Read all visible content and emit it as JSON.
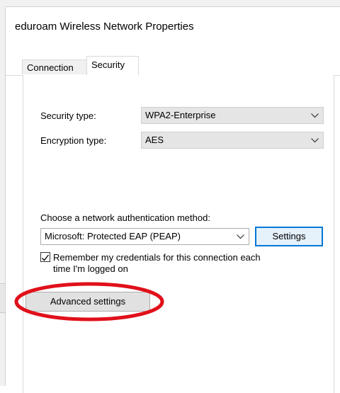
{
  "window": {
    "title": "eduroam Wireless Network Properties"
  },
  "tabs": [
    {
      "label": "Connection",
      "active": false
    },
    {
      "label": "Security",
      "active": true
    }
  ],
  "security": {
    "security_type_label": "Security type:",
    "security_type_value": "WPA2-Enterprise",
    "encryption_type_label": "Encryption type:",
    "encryption_type_value": "AES",
    "auth_method_label": "Choose a network authentication method:",
    "auth_method_value": "Microsoft: Protected EAP (PEAP)",
    "settings_button": "Settings",
    "remember_checked": true,
    "remember_text_line1": "Remember my credentials for this connection each",
    "remember_text_line2": "time I'm logged on",
    "advanced_button": "Advanced settings"
  },
  "colors": {
    "highlight_ellipse": "#e0101a",
    "focus_border": "#0078d7",
    "dropdown_bg": "#e5e5e5"
  },
  "icons": {
    "dropdown_caret": "chevron-down-icon",
    "checkbox": "checkmark-icon"
  }
}
